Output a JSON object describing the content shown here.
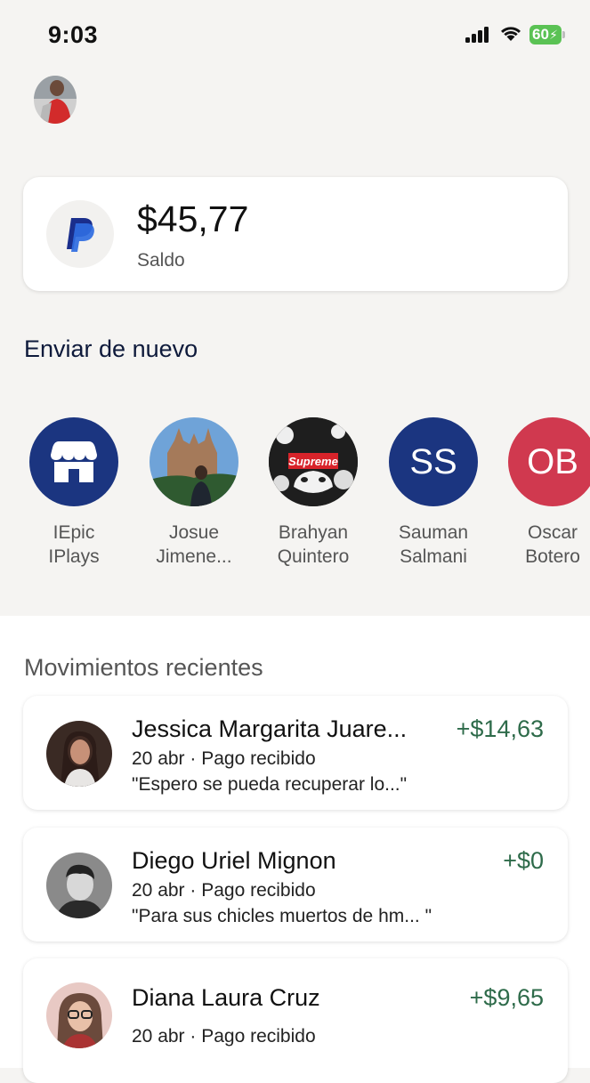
{
  "status_bar": {
    "time": "9:03",
    "battery": "60"
  },
  "balance": {
    "amount": "$45,77",
    "label": "Saldo"
  },
  "send_again": {
    "title": "Enviar de nuevo",
    "contacts": [
      {
        "line1": "IEpic",
        "line2": "IPlays"
      },
      {
        "line1": "Josue",
        "line2": "Jimene..."
      },
      {
        "line1": "Brahyan",
        "line2": "Quintero"
      },
      {
        "line1": "Sauman",
        "line2": "Salmani",
        "initials": "SS"
      },
      {
        "line1": "Oscar",
        "line2": "Botero",
        "initials": "OB"
      }
    ]
  },
  "recent": {
    "title": "Movimientos recientes",
    "items": [
      {
        "name": "Jessica Margarita Juare...",
        "amount": "+$14,63",
        "sub": "20 abr · Pago recibido",
        "note": "\"Espero se pueda recuperar lo...\""
      },
      {
        "name": "Diego Uriel Mignon",
        "amount": "+$0",
        "sub": "20 abr · Pago recibido",
        "note": "\"Para sus chicles muertos de hm...  \""
      },
      {
        "name": "Diana Laura Cruz",
        "amount": "+$9,65",
        "sub": "20 abr · Pago recibido",
        "note": ""
      }
    ]
  },
  "colors": {
    "accent_blue": "#1b3580",
    "ob_red": "#d0394f",
    "amount_green": "#2e6b4a",
    "battery_green": "#5ac254",
    "paypal_dark": "#1a2e8c",
    "paypal_light": "#2f6de1"
  }
}
